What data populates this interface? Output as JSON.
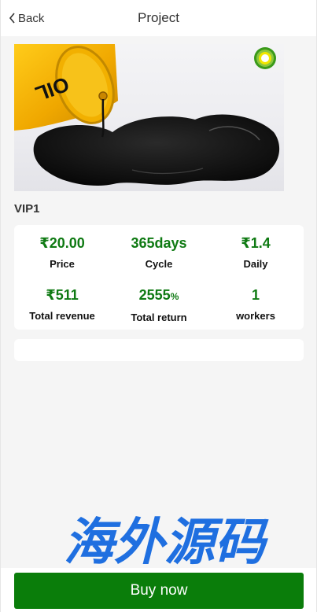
{
  "nav": {
    "back_label": "Back",
    "title": "Project"
  },
  "banner": {
    "image": "oil-barrel-spill-image",
    "barrel_text": "OIL",
    "logo": "bp-helios-logo-icon"
  },
  "product": {
    "name": "VIP1"
  },
  "stats": [
    {
      "value": "₹20.00",
      "label": "Price"
    },
    {
      "value": "365days",
      "label": "Cycle"
    },
    {
      "value": "₹1.4",
      "label": "Daily"
    },
    {
      "value": "₹511",
      "label": "Total revenue"
    },
    {
      "value": "2555",
      "unit": "%",
      "label": "Total return"
    },
    {
      "value": "1",
      "label": "workers"
    }
  ],
  "watermark": {
    "text": "海外源码"
  },
  "footer": {
    "buy_label": "Buy now"
  },
  "colors": {
    "accent_green": "#0a7d0a",
    "value_green": "#0f7a13",
    "watermark_blue": "#1f6fe0"
  }
}
